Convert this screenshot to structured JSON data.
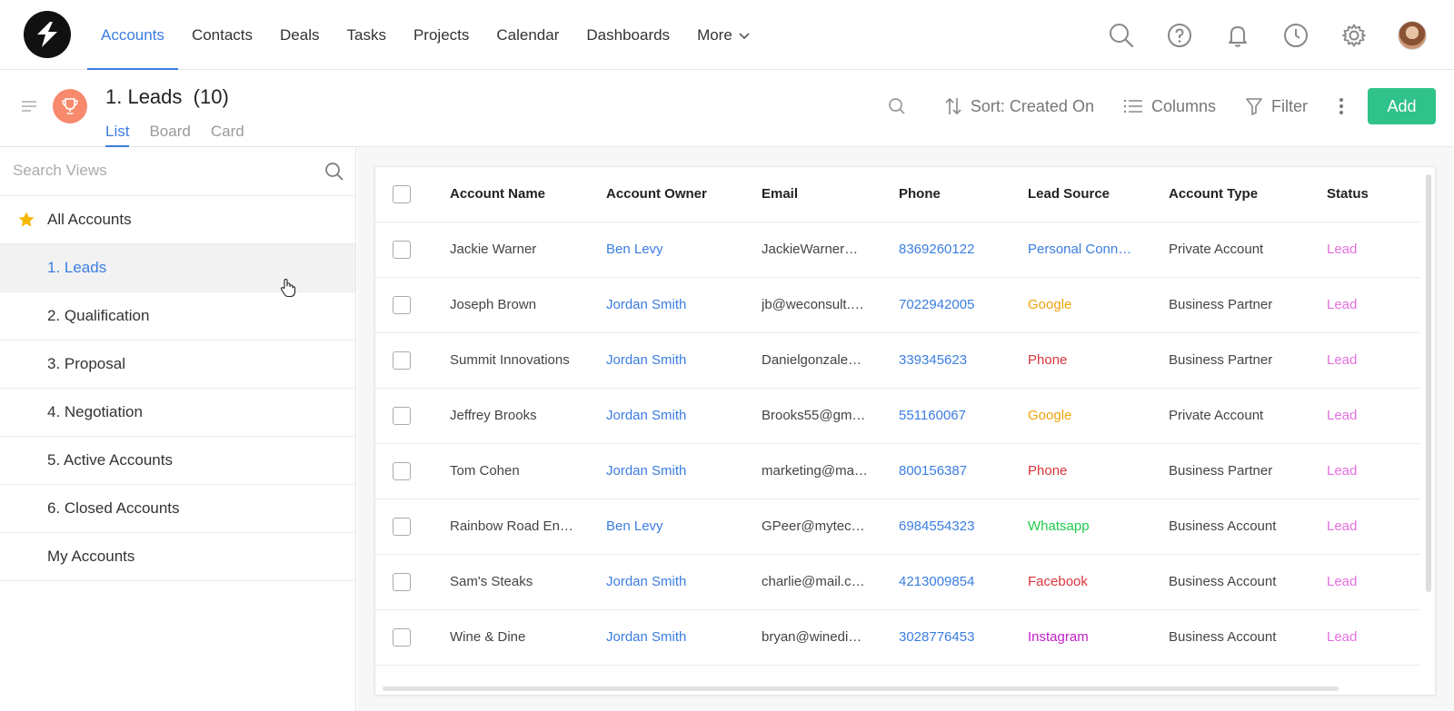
{
  "nav": {
    "links": [
      "Accounts",
      "Contacts",
      "Deals",
      "Tasks",
      "Projects",
      "Calendar",
      "Dashboards"
    ],
    "more_label": "More",
    "active_index": 0
  },
  "header": {
    "title": "1. Leads",
    "count": "(10)",
    "view_tabs": [
      "List",
      "Board",
      "Card"
    ],
    "sort_label": "Sort: Created On",
    "columns_label": "Columns",
    "filter_label": "Filter",
    "add_label": "Add"
  },
  "sidebar": {
    "search_placeholder": "Search Views",
    "items": [
      "All Accounts",
      "1. Leads",
      "2. Qualification",
      "3. Proposal",
      "4. Negotiation",
      "5. Active Accounts",
      "6. Closed Accounts",
      "My Accounts"
    ],
    "active_index": 1
  },
  "table": {
    "columns": [
      "Account Name",
      "Account Owner",
      "Email",
      "Phone",
      "Lead Source",
      "Account Type",
      "Status"
    ],
    "rows": [
      {
        "name": "Jackie Warner",
        "owner": "Ben Levy",
        "email": "JackieWarner…",
        "phone": "8369260122",
        "source": "Personal Conn…",
        "source_color": "#3b7de0",
        "type": "Private Account",
        "status": "Lead"
      },
      {
        "name": "Joseph Brown",
        "owner": "Jordan Smith",
        "email": "jb@weconsult.…",
        "phone": "7022942005",
        "source": "Google",
        "source_color": "#f0a30a",
        "type": "Business Partner",
        "status": "Lead"
      },
      {
        "name": "Summit Innovations",
        "owner": "Jordan Smith",
        "email": "Danielgonzale…",
        "phone": "339345623",
        "source": "Phone",
        "source_color": "#d9343a",
        "type": "Business Partner",
        "status": "Lead"
      },
      {
        "name": "Jeffrey Brooks",
        "owner": "Jordan Smith",
        "email": "Brooks55@gm…",
        "phone": "551160067",
        "source": "Google",
        "source_color": "#f0a30a",
        "type": "Private Account",
        "status": "Lead"
      },
      {
        "name": "Tom Cohen",
        "owner": "Jordan Smith",
        "email": "marketing@ma…",
        "phone": "800156387",
        "source": "Phone",
        "source_color": "#d9343a",
        "type": "Business Partner",
        "status": "Lead"
      },
      {
        "name": "Rainbow Road En…",
        "owner": "Ben Levy",
        "email": "GPeer@mytec…",
        "phone": "6984554323",
        "source": "Whatsapp",
        "source_color": "#20c94a",
        "type": "Business Account",
        "status": "Lead"
      },
      {
        "name": "Sam's Steaks",
        "owner": "Jordan Smith",
        "email": "charlie@mail.c…",
        "phone": "4213009854",
        "source": "Facebook",
        "source_color": "#d9343a",
        "type": "Business Account",
        "status": "Lead"
      },
      {
        "name": "Wine & Dine",
        "owner": "Jordan Smith",
        "email": "bryan@winedi…",
        "phone": "3028776453",
        "source": "Instagram",
        "source_color": "#c020c8",
        "type": "Business Account",
        "status": "Lead"
      }
    ],
    "status_color": "#e56fe0"
  },
  "colors": {
    "accent": "#3b7de0",
    "add_button": "#2fc28a",
    "trophy": "#f7896d"
  }
}
